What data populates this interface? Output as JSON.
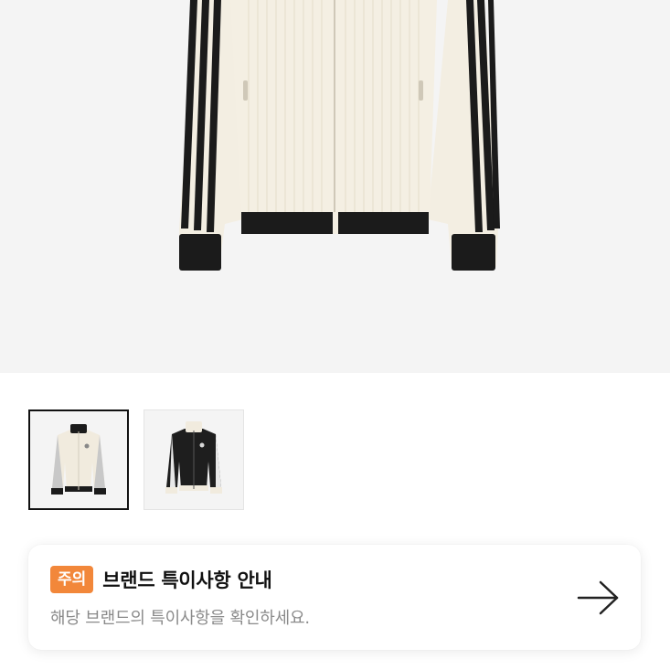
{
  "product": {
    "main_image": "cream-corduroy-track-jacket",
    "colors": {
      "cream": "#f3eee2",
      "black": "#1b1b1b",
      "hero_bg": "#f4f4f4"
    }
  },
  "thumbnails": [
    {
      "name": "cream-track-jacket",
      "selected": true
    },
    {
      "name": "black-track-jacket",
      "selected": false
    }
  ],
  "notice": {
    "badge": "주의",
    "title": "브랜드 특이사항 안내",
    "subtitle": "해당 브랜드의 특이사항을 확인하세요.",
    "icon": "arrow-right-icon",
    "badge_color": "#f2873a"
  }
}
